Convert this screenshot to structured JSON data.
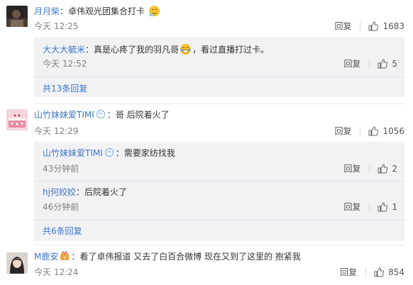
{
  "comments": [
    {
      "user": "月月柴",
      "text": "：卓伟观光团集合打卡",
      "time": "今天 12:25",
      "reply_label": "回复",
      "likes": "1683",
      "avatar_icon": "dark-photo-avatar"
    },
    {
      "user": "山竹妹妹爱TIMI",
      "text": "：哥 后院着火了",
      "time": "今天 12:29",
      "reply_label": "回复",
      "likes": "1056",
      "avatar_icon": "cake-photo-avatar"
    },
    {
      "user": "M鹿安",
      "text": "：看了卓伟报道 又去了白百合微博 现在又到了这里的 抱紧我",
      "time": "今天 12:24",
      "reply_label": "回复",
      "likes": "854",
      "avatar_icon": "girl-photo-avatar"
    }
  ],
  "replies_1": [
    {
      "user": "大大大毓米",
      "text_before": "：真是心疼了我的羽凡哥",
      "text_after": "，看过直播打过卡。",
      "time": "今天 12:52",
      "reply_label": "回复",
      "likes": "5"
    }
  ],
  "more_1": "共13条回复",
  "replies_2": [
    {
      "user": "山竹妹妹爱TIMI",
      "text": "：需要家纺找我",
      "time": "43分钟前",
      "reply_label": "回复",
      "likes": "2"
    },
    {
      "user": "hj何姣姣",
      "text": "：后院着火了",
      "time": "46分钟前",
      "reply_label": "回复",
      "likes": "1"
    }
  ],
  "more_2": "共6条回复",
  "colors": {
    "link": "#3b77c6",
    "reply_bg": "#f2f2f5",
    "muted": "#808080"
  }
}
